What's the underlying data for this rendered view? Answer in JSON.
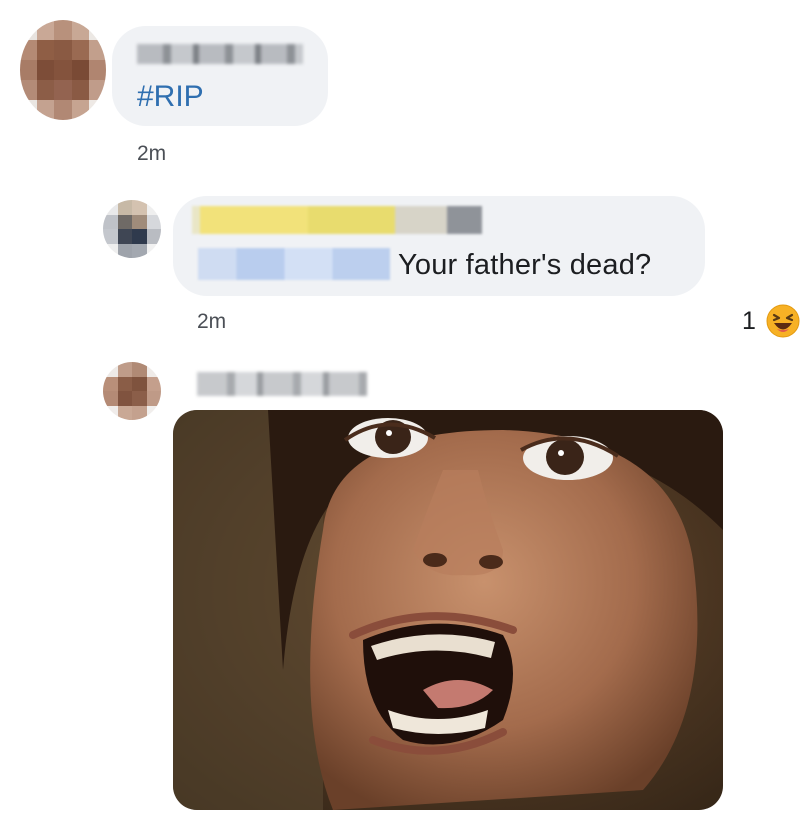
{
  "comments": [
    {
      "text": "#RIP",
      "time": "2m"
    },
    {
      "text": "Your father's dead?",
      "time": "2m",
      "reactions": {
        "count": "1",
        "icon": "laughing-face-icon"
      }
    },
    {
      "attachment": "shocked-face-photo"
    }
  ],
  "colors": {
    "link": "#2f6fb0",
    "bubble": "#f0f2f5",
    "meta": "#4b4f56"
  }
}
